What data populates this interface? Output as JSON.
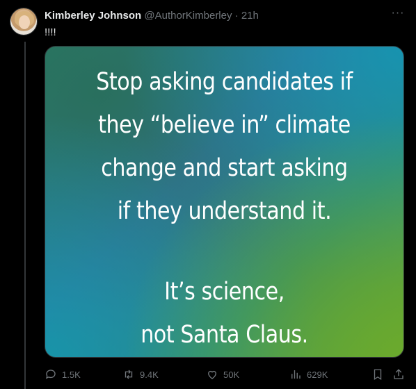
{
  "tweet": {
    "author_name": "Kimberley Johnson",
    "author_handle": "@AuthorKimberley",
    "separator": "·",
    "time": "21h",
    "text": "!!!!",
    "more_label": "···"
  },
  "media": {
    "lines_top": [
      "Stop asking candidates if",
      "they “believe in” climate",
      "change and start asking",
      "if they understand it."
    ],
    "lines_bottom": [
      "It’s science,",
      "not Santa Claus."
    ]
  },
  "actions": {
    "reply": {
      "icon": "reply-icon",
      "count": "1.5K"
    },
    "retweet": {
      "icon": "retweet-icon",
      "count": "9.4K"
    },
    "like": {
      "icon": "heart-icon",
      "count": "50K"
    },
    "views": {
      "icon": "views-icon",
      "count": "629K"
    },
    "bookmark": {
      "icon": "bookmark-icon"
    },
    "share": {
      "icon": "share-icon"
    }
  }
}
